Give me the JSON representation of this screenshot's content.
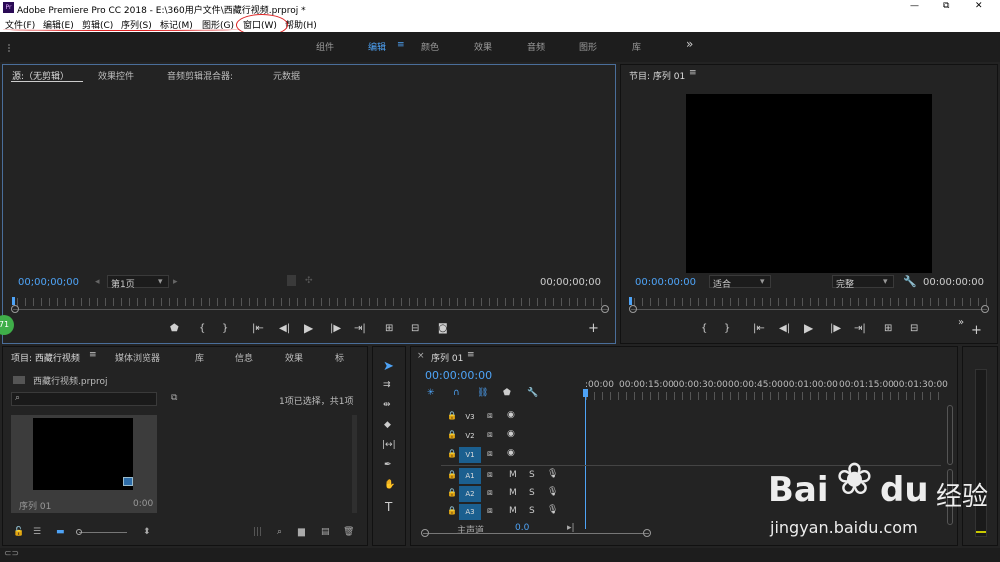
{
  "window": {
    "title": "Adobe Premiere Pro CC 2018 - E:\\360用户文件\\西藏行视频.prproj *",
    "app_icon": "Pr",
    "minimize": "—",
    "restore": "⧉",
    "close": "✕"
  },
  "menu": [
    "文件(F)",
    "编辑(E)",
    "剪辑(C)",
    "序列(S)",
    "标记(M)",
    "图形(G)",
    "窗口(W)",
    "帮助(H)"
  ],
  "workspaces": {
    "items": [
      "组件",
      "编辑",
      "颜色",
      "效果",
      "音频",
      "图形",
      "库"
    ],
    "active": "编辑",
    "more": "»"
  },
  "source_panel": {
    "tabs": [
      "源:（无剪辑）",
      "效果控件",
      "音频剪辑混合器:",
      "元数据"
    ],
    "timecode_left": "00;00;00;00",
    "page_select": "第1页",
    "timecode_right": "00;00;00;00"
  },
  "program_panel": {
    "title": "节目: 序列 01",
    "timecode_left": "00:00:00:00",
    "fit_select": "适合",
    "quality_select": "完整",
    "timecode_right": "00:00:00:00"
  },
  "project_panel": {
    "tabs": [
      "项目: 西藏行视频",
      "媒体浏览器",
      "库",
      "信息",
      "效果",
      "标"
    ],
    "file_name": "西藏行视频.prproj",
    "selection_status": "1项已选择，共1项",
    "clip_name": "序列 01",
    "clip_duration": "0:00"
  },
  "timeline": {
    "tab": "序列 01",
    "timecode": "00:00:00:00",
    "ruler": [
      ":00:00",
      "00:00:15:00",
      "00:00:30:00",
      "00:00:45:00",
      "00:01:00:00",
      "00:01:15:00",
      "00:01:30:00"
    ],
    "video_tracks": [
      "V3",
      "V2",
      "V1"
    ],
    "audio_tracks": [
      "A1",
      "A2",
      "A3"
    ],
    "master_label": "主声道",
    "master_value": "0.0"
  },
  "badge": "71",
  "watermark": {
    "brand": "Bai",
    "brand2": "du",
    "brand_cn": "经验",
    "url": "jingyan.baidu.com"
  }
}
